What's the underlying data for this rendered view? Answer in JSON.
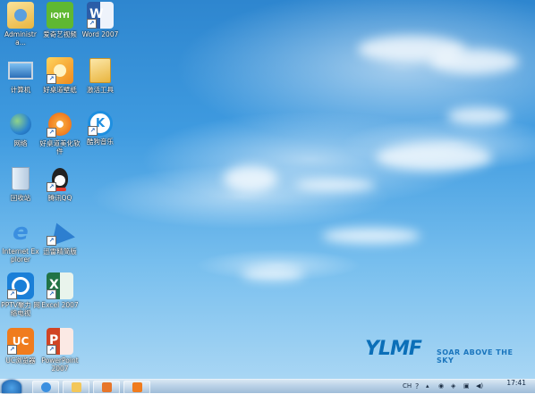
{
  "desktop": {
    "icons": [
      {
        "label": "Administra...",
        "icon": "user-folder-icon",
        "color": "#f2c94c"
      },
      {
        "label": "爱奇艺视频",
        "icon": "iqiyi-icon",
        "color": "#5fb832",
        "text": "iQIYI"
      },
      {
        "label": "Word 2007",
        "icon": "word-document-icon",
        "color": "#2b5da8",
        "text": "W"
      },
      {
        "label": "计算机",
        "icon": "computer-icon",
        "color": "#5a8fc9"
      },
      {
        "label": "好桌道壁纸",
        "icon": "wallpaper-app-icon",
        "color": "#f5a623"
      },
      {
        "label": "激活工具",
        "icon": "folder-icon",
        "color": "#f3c75a"
      },
      {
        "label": "网络",
        "icon": "network-globe-icon",
        "color": "#3a8fd4"
      },
      {
        "label": "好桌道美化软件",
        "icon": "beautify-app-icon",
        "color": "#f07a1e"
      },
      {
        "label": "酷狗音乐",
        "icon": "kugou-music-icon",
        "color": "#1e8fe0",
        "text": "K"
      },
      {
        "label": "回收站",
        "icon": "recycle-bin-icon",
        "color": "#c9d9ea"
      },
      {
        "label": "腾讯QQ",
        "icon": "qq-penguin-icon",
        "color": "#222222"
      },
      {
        "label": "Internet Explorer",
        "icon": "internet-explorer-icon",
        "color": "#3b8fe0",
        "text": "e"
      },
      {
        "label": "迅雷精简版",
        "icon": "xunlei-bird-icon",
        "color": "#2d7fd0"
      },
      {
        "label": "PPTV聚力 网络电视",
        "icon": "pptv-icon",
        "color": "#1a7fd8"
      },
      {
        "label": "Excel 2007",
        "icon": "excel-document-icon",
        "color": "#217346",
        "text": "X"
      },
      {
        "label": "UC浏览器",
        "icon": "uc-browser-icon",
        "color": "#f07c1e"
      },
      {
        "label": "PowerPoint 2007",
        "icon": "powerpoint-document-icon",
        "color": "#d14424",
        "text": "P"
      }
    ]
  },
  "wallpaper": {
    "brand_logo": "YLMF",
    "tagline": "SOAR ABOVE THE SKY"
  },
  "taskbar": {
    "pinned": [
      {
        "name": "internet-explorer",
        "icon": "internet-explorer-icon",
        "color": "#3b8fe0"
      },
      {
        "name": "file-explorer",
        "icon": "folder-icon",
        "color": "#f3c75a"
      },
      {
        "name": "media-player",
        "icon": "media-player-icon",
        "color": "#e7762a"
      },
      {
        "name": "uc-browser",
        "icon": "uc-browser-icon",
        "color": "#f07c1e"
      }
    ],
    "tray": {
      "ime_label": "CH",
      "clock_time": "17:41"
    }
  }
}
